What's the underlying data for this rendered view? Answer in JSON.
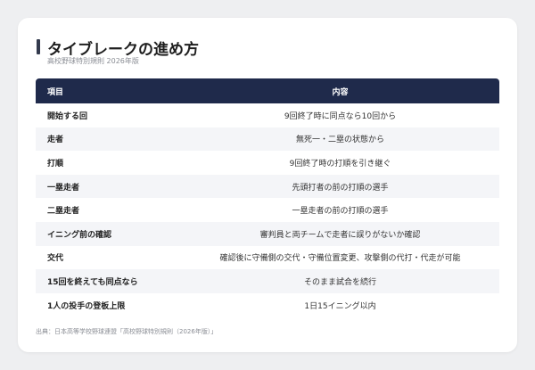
{
  "header": {
    "title": "タイブレークの進め方",
    "subtitle": "高校野球特別規則 2026年版"
  },
  "table": {
    "columns": [
      "項目",
      "内容"
    ],
    "rows": [
      {
        "item": "開始する回",
        "content": "9回終了時に同点なら10回から"
      },
      {
        "item": "走者",
        "content": "無死一・二塁の状態から"
      },
      {
        "item": "打順",
        "content": "9回終了時の打順を引き継ぐ"
      },
      {
        "item": "一塁走者",
        "content": "先頭打者の前の打順の選手"
      },
      {
        "item": "二塁走者",
        "content": "一塁走者の前の打順の選手"
      },
      {
        "item": "イニング前の確認",
        "content": "審判員と両チームで走者に誤りがないか確認"
      },
      {
        "item": "交代",
        "content": "確認後に守備側の交代・守備位置変更、攻撃側の代打・代走が可能"
      },
      {
        "item": "15回を終えても同点なら",
        "content": "そのまま試合を続行"
      },
      {
        "item": "1人の投手の登板上限",
        "content": "1日15イニング以内"
      }
    ]
  },
  "footer": {
    "source": "出典：日本高等学校野球連盟「高校野球特別規則（2026年版）」"
  },
  "colors": {
    "header_bg": "#1f2a4b",
    "accent_bar": "#333a4d"
  }
}
